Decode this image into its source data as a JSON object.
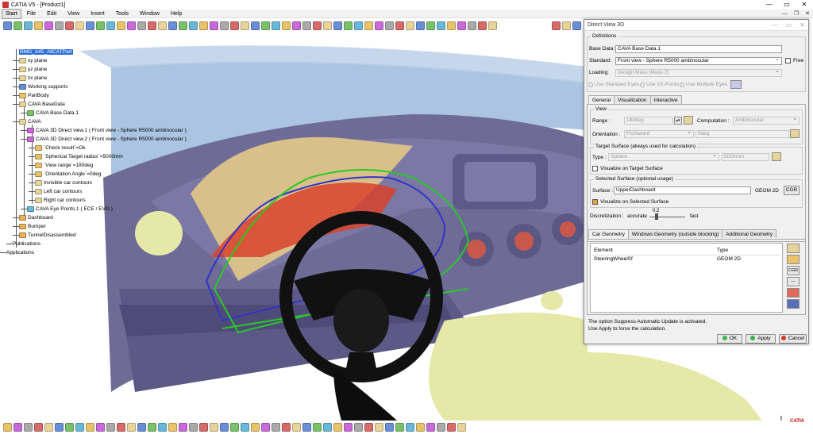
{
  "window": {
    "title": "CATIA V5 - [Product1]",
    "controls": [
      "—",
      "▭",
      "✕"
    ],
    "doc_controls": [
      "—",
      "❐",
      "✕"
    ]
  },
  "menu": [
    "Start",
    "File",
    "Edit",
    "View",
    "Insert",
    "Tools",
    "Window",
    "Help"
  ],
  "tree": {
    "root_label": "RMG_A45_AllCATPart",
    "nodes": [
      {
        "label": "xy plane",
        "icon": "plane-icon"
      },
      {
        "label": "yz plane",
        "icon": "plane-icon"
      },
      {
        "label": "zx plane",
        "icon": "plane-icon"
      },
      {
        "label": "Working supports",
        "icon": "grid-icon"
      },
      {
        "label": "PartBody",
        "icon": "body-icon"
      },
      {
        "label": "CAVA BaseData",
        "icon": "set-icon"
      },
      {
        "label": "CAVA Base Data.1",
        "icon": "data-icon"
      },
      {
        "label": "CAVA",
        "icon": "set-icon"
      },
      {
        "label": "CAVA 3D Direct view.1 ( Front view - Sphere R5000 ambinocular )",
        "icon": "view-icon"
      },
      {
        "label": "CAVA 3D Direct view.2 ( Front view - Sphere R5000 ambinocular )",
        "icon": "view-icon"
      },
      {
        "label": "`Check result`=Ok",
        "icon": "param-icon"
      },
      {
        "label": "`Spherical Target radius`=5000mm",
        "icon": "param-icon"
      },
      {
        "label": "`View range`=180deg",
        "icon": "param-icon"
      },
      {
        "label": "`Orientation Angle`=0deg",
        "icon": "param-icon"
      },
      {
        "label": "Invisible car contours",
        "icon": "folder-icon"
      },
      {
        "label": "Left car contours",
        "icon": "folder-icon"
      },
      {
        "label": "Right car contours",
        "icon": "folder-icon"
      },
      {
        "label": "CAVA Eye Points.1 ( ECE / EVG )",
        "icon": "eye-icon"
      },
      {
        "label": "Dashboard",
        "icon": "part-icon"
      },
      {
        "label": "Bumper",
        "icon": "part-icon"
      },
      {
        "label": "TunnelDisassembled",
        "icon": "part-icon"
      },
      {
        "label": "Publications",
        "icon": "none"
      },
      {
        "label": "Applications",
        "icon": "none"
      }
    ]
  },
  "dialog": {
    "title": "Direct View 3D",
    "definitions_legend": "Definitions",
    "base_data_label": "Base Data:",
    "base_data_value": "CAVA Base Data.1",
    "standard_label": "Standard:",
    "standard_value": "Front view - Sphere R5000 ambinocular",
    "free_label": "Free",
    "loading_label": "Loading:",
    "loading_value": "Design Mass (Mass 2)",
    "eyes_options": [
      "Use Standard Eyes",
      "Use V5 Points",
      "Use Multiple Eyes"
    ],
    "tabs": [
      "General",
      "Visualization",
      "Interactive"
    ],
    "view_legend": "View",
    "range_label": "Range :",
    "range_value": "180deg",
    "computation_label": "Computation :",
    "computation_value": "Ambinocular",
    "orientation_label": "Orientation :",
    "orientation_value": "Frontward",
    "orientation_angle": "0deg",
    "target_legend": "Target Surface (always used for calculation)",
    "type_label": "Type :",
    "type_value": "Sphere",
    "type_radius": "5000mm",
    "visualize_target": "Visualize on Target Surface",
    "selected_legend": "Selected Surface (optional usage)",
    "surface_label": "Surface :",
    "surface_value": "UpperDashboard",
    "surface_type": "GEOM 2D",
    "cgr_label": "CGR",
    "visualize_selected": "Visualize on Selected Surface",
    "discretization_label": "Discretization :",
    "accurate_label": "accurate",
    "disc_value": "0.2",
    "fast_label": "fast",
    "geom_tabs": [
      "Car Geometry",
      "Windows Geometry (outside blocking)",
      "Additional Geometry"
    ],
    "table_headers": [
      "Element",
      "Type"
    ],
    "table_rows": [
      {
        "element": "SteeringWheelSf",
        "type": "GEOM 2D"
      }
    ],
    "side_buttons": [
      "",
      "",
      "CGR",
      "—",
      "",
      ""
    ],
    "message_line1": "The option Suppress Automatic Update is activated.",
    "message_line2": "Use Apply to force the calculation.",
    "ok_label": "OK",
    "apply_label": "Apply",
    "cancel_label": "Cancel"
  },
  "logo_text": "CATIA",
  "colors": {
    "accent_blue": "#2f6fd6",
    "dashboard_purple": "#6f6b97",
    "windshield_blue": "#8fb0d8",
    "seat_yellow": "#e6e8a8",
    "green_contour": "#28c828",
    "red_area": "#d8432b"
  }
}
